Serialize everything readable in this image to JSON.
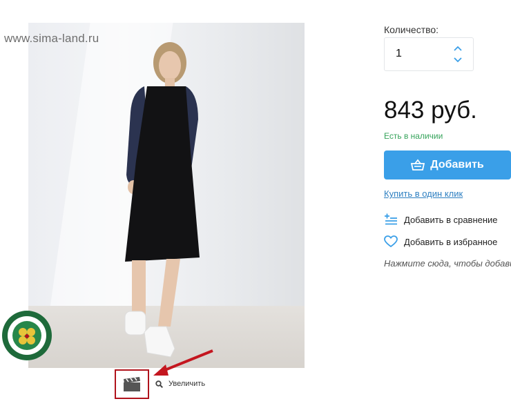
{
  "gallery": {
    "watermark": "www.sima-land.ru",
    "zoom_label": "Увеличить"
  },
  "purchase": {
    "quantity_label": "Количество:",
    "quantity_value": "1",
    "price": "843 руб.",
    "stock_status": "Есть в наличии",
    "add_button_label": "Добавить",
    "one_click_link": "Купить в один клик",
    "compare_label": "Добавить в сравнение",
    "favorite_label": "Добавить в избранное",
    "hint": "Нажмите сюда, чтобы добави"
  },
  "colors": {
    "accent": "#3a9fe8",
    "in_stock": "#35a35a",
    "link": "#2d7fc1",
    "highlight": "#b0121b"
  },
  "icons": [
    "video-icon",
    "search-icon",
    "basket-icon",
    "compare-icon",
    "heart-icon",
    "chevron-up-icon",
    "chevron-down-icon"
  ]
}
